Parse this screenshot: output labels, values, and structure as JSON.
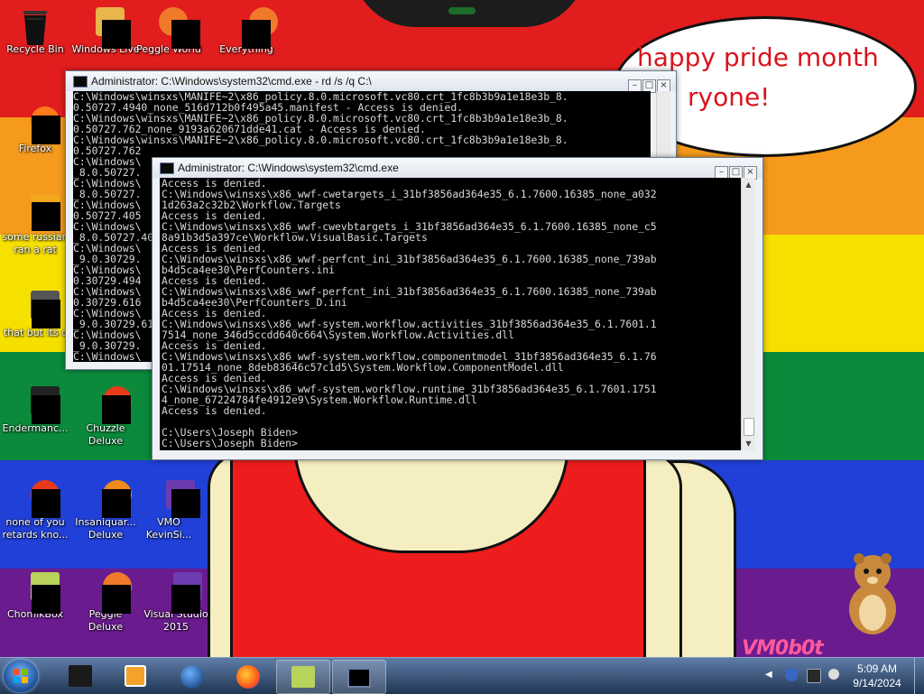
{
  "desktop": {
    "bubble": {
      "line1": "happy pride month",
      "line2": "ryone!"
    },
    "watermark": "VM0b0t",
    "icons": [
      {
        "label": "Recycle Bin",
        "icon": "recycle-bin-icon"
      },
      {
        "label": "Windows Live",
        "icon": "windows-live-icon"
      },
      {
        "label": "Peggle World",
        "icon": "peggle-world-icon"
      },
      {
        "label": "Everything",
        "icon": "everything-icon"
      },
      {
        "label": "Firefox",
        "icon": "firefox-icon"
      },
      {
        "label": "some russian ran a rat",
        "icon": "shortcut-icon"
      },
      {
        "label": "that but its c",
        "icon": "stack-icon"
      },
      {
        "label": "Endermanc...",
        "icon": "endermanch-icon"
      },
      {
        "label": "Chuzzle Deluxe",
        "icon": "chuzzle-icon"
      },
      {
        "label": "none of you retards kno...",
        "icon": "shortcut-icon"
      },
      {
        "label": "Insaniquar... Deluxe",
        "icon": "insaniquarium-icon"
      },
      {
        "label": "VMO KevinSi...",
        "icon": "vmo-icon"
      },
      {
        "label": "ChomikBox",
        "icon": "chomikbox-icon"
      },
      {
        "label": "Peggle Deluxe",
        "icon": "peggle-deluxe-icon"
      },
      {
        "label": "Visual Studio 2015",
        "icon": "visual-studio-icon"
      }
    ]
  },
  "windows": {
    "back": {
      "title": "Administrator: C:\\Windows\\system32\\cmd.exe - rd  /s /q C:\\",
      "text": "C:\\Windows\\winsxs\\MANIFE~2\\x86_policy.8.0.microsoft.vc80.crt_1fc8b3b9a1e18e3b_8.\n0.50727.4940_none_516d712b0f495a45.manifest - Access is denied.\nC:\\Windows\\winsxs\\MANIFE~2\\x86_policy.8.0.microsoft.vc80.crt_1fc8b3b9a1e18e3b_8.\n0.50727.762_none_9193a620671dde41.cat - Access is denied.\nC:\\Windows\\winsxs\\MANIFE~2\\x86_policy.8.0.microsoft.vc80.crt_1fc8b3b9a1e18e3b_8.\n0.50727.762\nC:\\Windows\\\n_8.0.50727.\nC:\\Windows\\\n_8.0.50727.\nC:\\Windows\\\n0.50727.405\nC:\\Windows\\\n_8.0.50727.405\nC:\\Windows\\\n_9.0.30729.\nC:\\Windows\\\n0.30729.494\nC:\\Windows\\\n0.30729.616\nC:\\Windows\\\n_9.0.30729.616\nC:\\Windows\\\n_9.0.30729.\nC:\\Windows\\\n_9.0.30729."
    },
    "front": {
      "title": "Administrator: C:\\Windows\\system32\\cmd.exe",
      "text": "Access is denied.\nC:\\Windows\\winsxs\\x86_wwf-cwetargets_i_31bf3856ad364e35_6.1.7600.16385_none_a032\n1d263a2c32b2\\Workflow.Targets\nAccess is denied.\nC:\\Windows\\winsxs\\x86_wwf-cwevbtargets_i_31bf3856ad364e35_6.1.7600.16385_none_c5\n8a91b3d5a397ce\\Workflow.VisualBasic.Targets\nAccess is denied.\nC:\\Windows\\winsxs\\x86_wwf-perfcnt_ini_31bf3856ad364e35_6.1.7600.16385_none_739ab\nb4d5ca4ee30\\PerfCounters.ini\nAccess is denied.\nC:\\Windows\\winsxs\\x86_wwf-perfcnt_ini_31bf3856ad364e35_6.1.7600.16385_none_739ab\nb4d5ca4ee30\\PerfCounters_D.ini\nAccess is denied.\nC:\\Windows\\winsxs\\x86_wwf-system.workflow.activities_31bf3856ad364e35_6.1.7601.1\n7514_none_346d5ccdd640c664\\System.Workflow.Activities.dll\nAccess is denied.\nC:\\Windows\\winsxs\\x86_wwf-system.workflow.componentmodel_31bf3856ad364e35_6.1.76\n01.17514_none_8deb83646c57c1d5\\System.Workflow.ComponentModel.dll\nAccess is denied.\nC:\\Windows\\winsxs\\x86_wwf-system.workflow.runtime_31bf3856ad364e35_6.1.7601.1751\n4_none_67224784fe4912e9\\System.Workflow.Runtime.dll\nAccess is denied.\n\nC:\\Users\\Joseph Biden>\nC:\\Users\\Joseph Biden>"
    }
  },
  "taskbar": {
    "clock": {
      "time": "5:09 AM",
      "date": "9/14/2024"
    },
    "pinned": [
      {
        "icon": "cmd-dark-icon",
        "active": false
      },
      {
        "icon": "media-player-icon",
        "active": false
      },
      {
        "icon": "globe-icon",
        "active": false
      },
      {
        "icon": "firefox-icon",
        "active": false
      },
      {
        "icon": "chomikbox-icon",
        "active": true
      },
      {
        "icon": "cmd-icon",
        "active": true
      }
    ]
  },
  "colors": {
    "accent": "#d8141d",
    "taskbar": "#203552"
  }
}
